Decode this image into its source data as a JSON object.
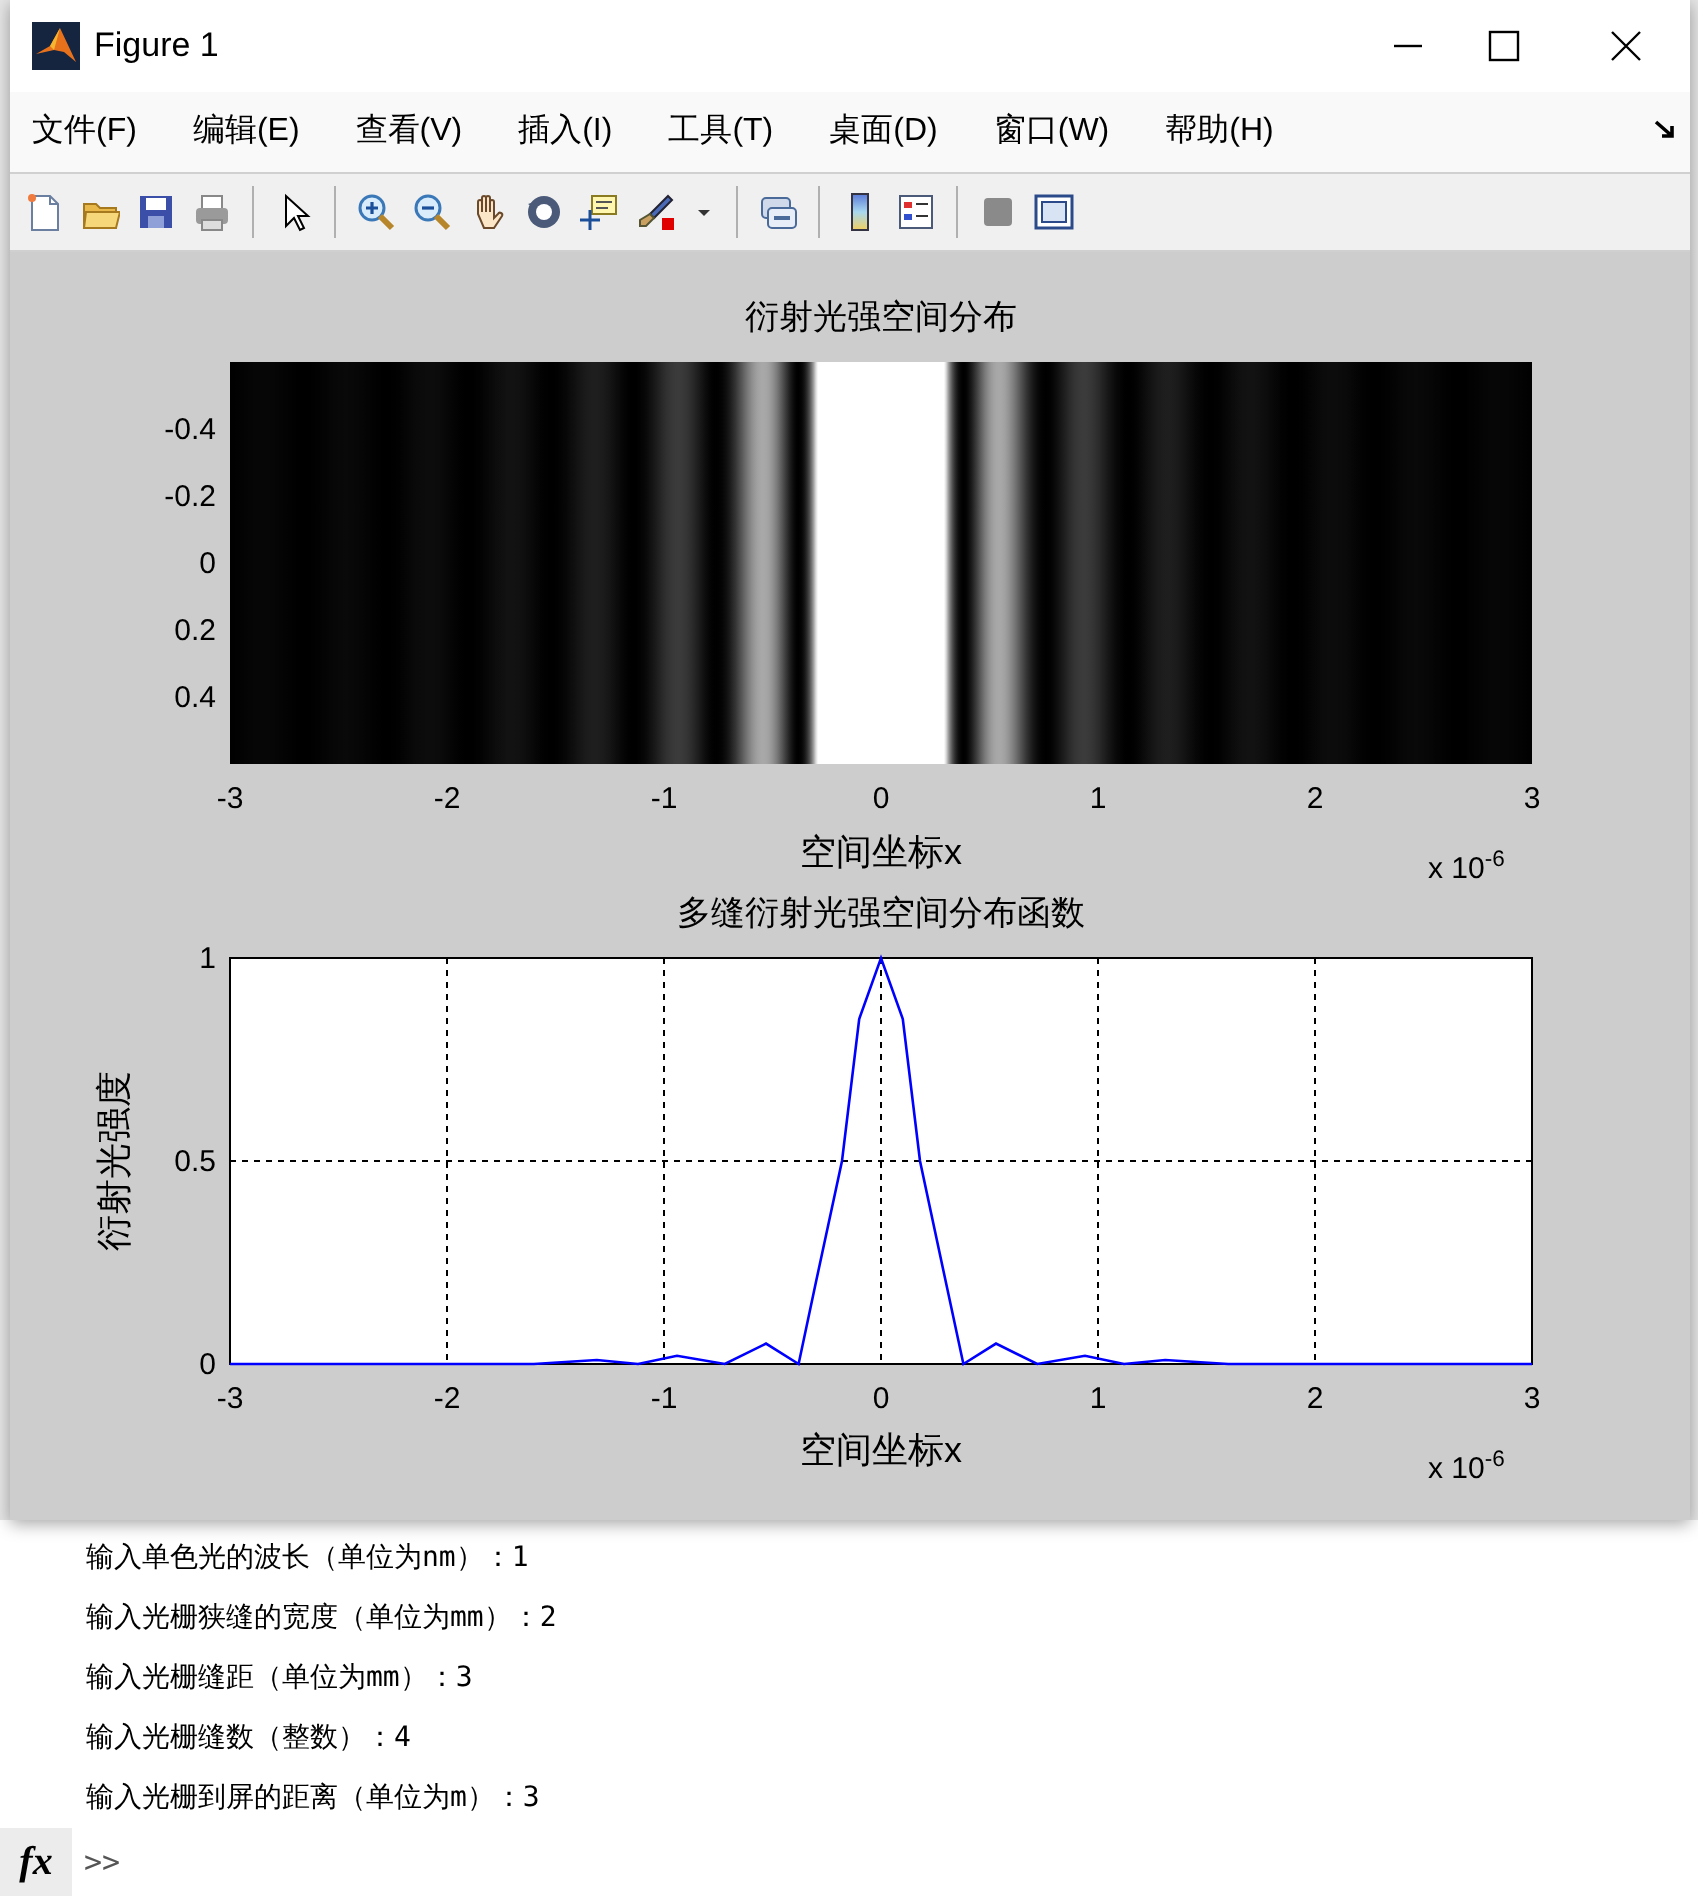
{
  "window": {
    "title": "Figure 1"
  },
  "menu": [
    {
      "label": "文件(F)"
    },
    {
      "label": "编辑(E)"
    },
    {
      "label": "查看(V)"
    },
    {
      "label": "插入(I)"
    },
    {
      "label": "工具(T)"
    },
    {
      "label": "桌面(D)"
    },
    {
      "label": "窗口(W)"
    },
    {
      "label": "帮助(H)"
    }
  ],
  "image_plot": {
    "title": "衍射光强空间分布",
    "xlabel": "空间坐标x",
    "xticks": [
      "-3",
      "-2",
      "-1",
      "0",
      "1",
      "2",
      "3"
    ],
    "yticks": [
      "-0.4",
      "-0.2",
      "0",
      "0.2",
      "0.4"
    ],
    "x_exponent": "x 10$^{-6}$"
  },
  "line_plot": {
    "x_exponent": "x 10$^{-6}$",
    "chart_data": {
      "type": "line",
      "title": "多缝衍射光强空间分布函数",
      "xlabel": "空间坐标x",
      "ylabel": "衍射光强度",
      "x": [
        -3,
        -1.6,
        -1.31,
        -1.12,
        -0.94,
        -0.72,
        -0.53,
        -0.38,
        -0.3,
        -0.18,
        -0.1,
        0,
        0.1,
        0.18,
        0.3,
        0.38,
        0.53,
        0.72,
        0.94,
        1.12,
        1.31,
        1.6,
        3
      ],
      "series": [
        {
          "color": "#0000ff",
          "values": [
            0,
            0,
            0.01,
            0,
            0.02,
            0,
            0.05,
            0,
            0.2,
            0.5,
            0.85,
            1,
            0.85,
            0.5,
            0.2,
            0,
            0.05,
            0,
            0.02,
            0,
            0.01,
            0,
            0
          ]
        }
      ],
      "xlim": [
        -3,
        3
      ],
      "ylim": [
        0,
        1
      ],
      "xticks": [
        -3,
        -2,
        -1,
        0,
        1,
        2,
        3
      ],
      "yticks": [
        0,
        0.5,
        1
      ],
      "grid": true
    }
  },
  "command_window": {
    "lines": [
      "输入单色光的波长（单位为nm）：1",
      "输入光栅狭缝的宽度（单位为mm）：2",
      "输入光栅缝距（单位为mm）：3",
      "输入光栅缝数（整数）：4",
      "输入光栅到屏的距离（单位为m）：3"
    ],
    "function_button": "fx",
    "prompt": ">>"
  }
}
